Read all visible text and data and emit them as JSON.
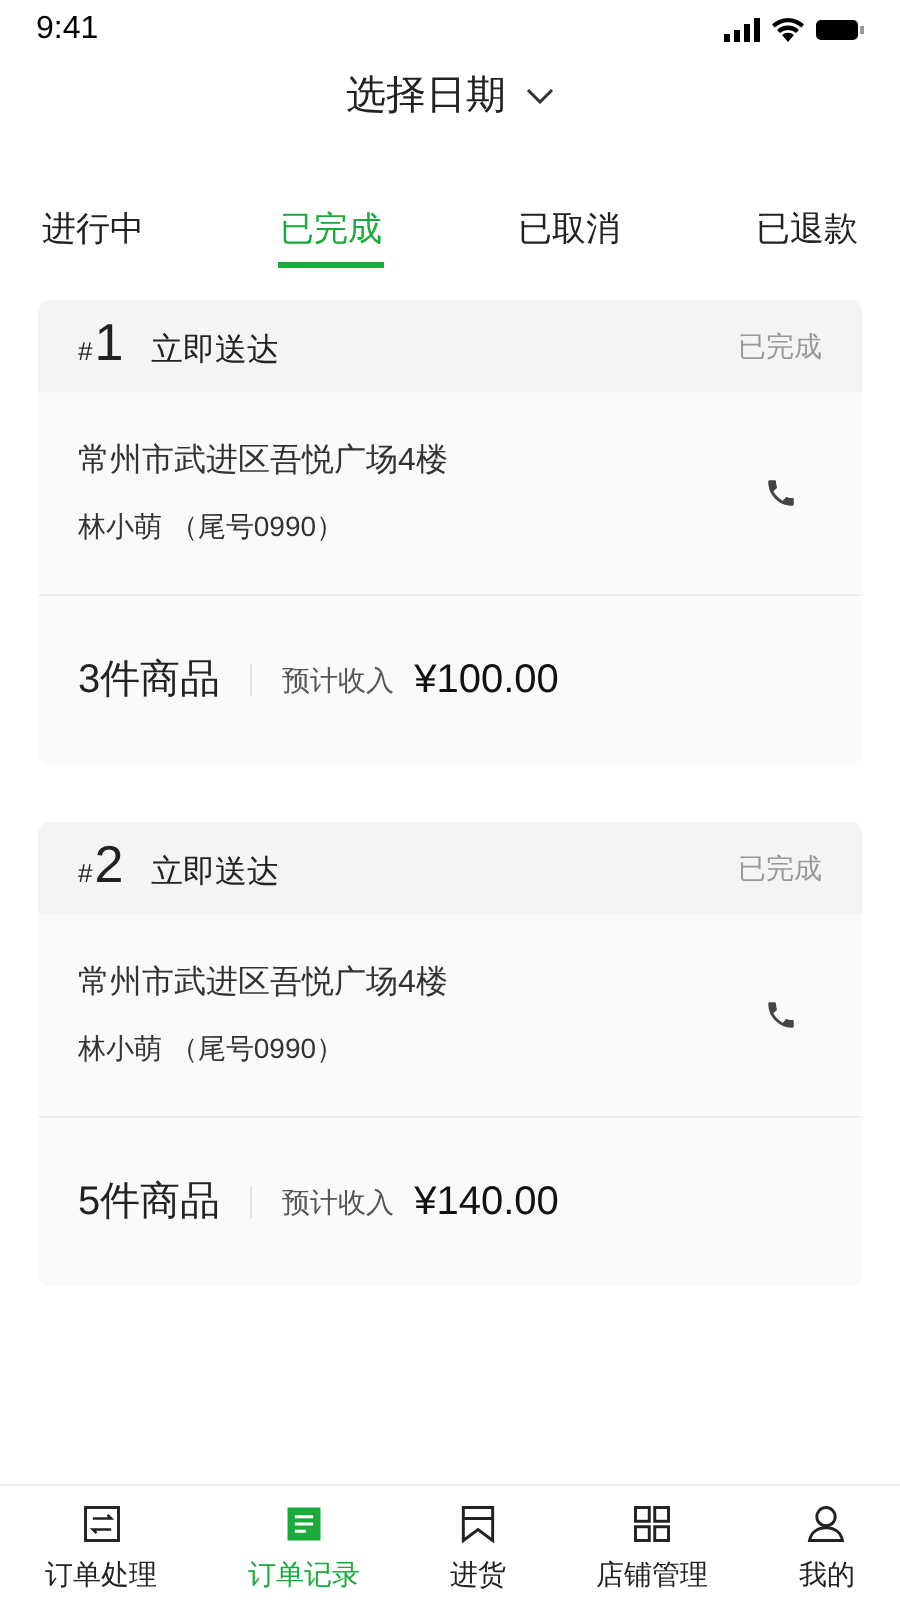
{
  "status_bar": {
    "time": "9:41"
  },
  "header": {
    "title": "选择日期"
  },
  "tabs": [
    {
      "label": "进行中",
      "selected": false
    },
    {
      "label": "已完成",
      "selected": true
    },
    {
      "label": "已取消",
      "selected": false
    },
    {
      "label": "已退款",
      "selected": false
    }
  ],
  "orders": [
    {
      "hash": "#",
      "number": "1",
      "type": "立即送达",
      "status": "已完成",
      "address": "常州市武进区吾悦广场4楼",
      "customer": "林小萌 （尾号0990）",
      "items": "3件商品",
      "income_label": "预计收入",
      "income": "¥100.00"
    },
    {
      "hash": "#",
      "number": "2",
      "type": "立即送达",
      "status": "已完成",
      "address": "常州市武进区吾悦广场4楼",
      "customer": "林小萌 （尾号0990）",
      "items": "5件商品",
      "income_label": "预计收入",
      "income": "¥140.00"
    }
  ],
  "bottom_nav": [
    {
      "label": "订单处理",
      "selected": false
    },
    {
      "label": "订单记录",
      "selected": true
    },
    {
      "label": "进货",
      "selected": false
    },
    {
      "label": "店铺管理",
      "selected": false
    },
    {
      "label": "我的",
      "selected": false
    }
  ]
}
